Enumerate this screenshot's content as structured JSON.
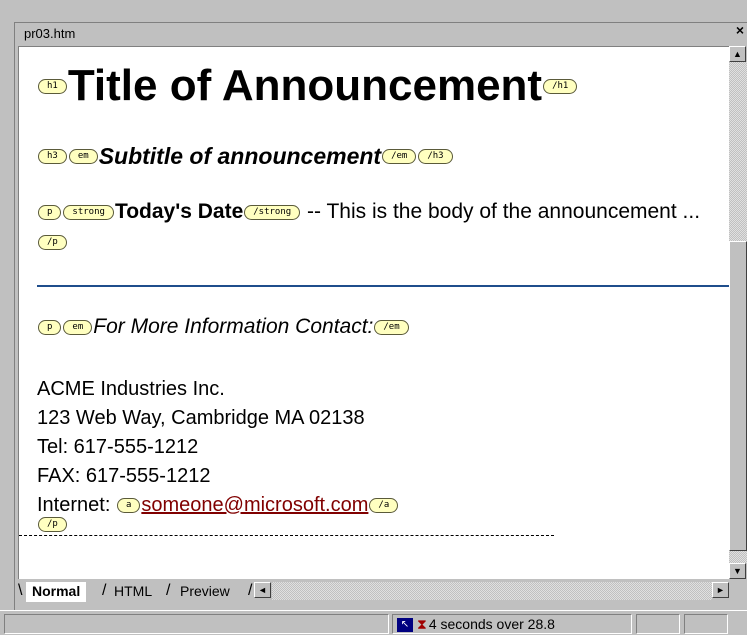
{
  "window": {
    "title": "pr03.htm",
    "close_glyph": "×"
  },
  "document": {
    "h1": {
      "open_tag": "h1",
      "text": "Title of Announcement",
      "close_tag": "/h1"
    },
    "h3": {
      "open_tag": "h3",
      "em_open_tag": "em",
      "text": "Subtitle of announcement",
      "em_close_tag": "/em",
      "close_tag": "/h3"
    },
    "body_paragraph": {
      "p_open_tag": "p",
      "strong_open_tag": "strong",
      "strong_text": "Today's Date",
      "strong_close_tag": "/strong",
      "text_after": " -- This is the body of the announcement ...",
      "p_close_tag": "/p"
    },
    "contact": {
      "p_open_tag": "p",
      "em_open_tag": "em",
      "text": "For More Information Contact:",
      "em_close_tag": "/em",
      "company": "ACME Industries Inc.",
      "street": "123 Web Way, Cambridge MA 02138",
      "tel": "Tel: 617-555-1212",
      "fax": "FAX: 617-555-1212",
      "internet_label": "Internet: ",
      "a_open_tag": "a",
      "email": "someone@microsoft.com",
      "a_close_tag": "/a",
      "p_close_tag": "/p"
    }
  },
  "tabs": [
    {
      "label": "Normal",
      "active": true
    },
    {
      "label": "HTML",
      "active": false
    },
    {
      "label": "Preview",
      "active": false
    }
  ],
  "status": {
    "download_text": "4 seconds over 28.8"
  },
  "colors": {
    "tag_fill": "#ffffc0",
    "link": "#800000",
    "hr": "#1f4e8c"
  },
  "icons": {
    "scroll_up": "up-arrow-icon",
    "scroll_down": "down-arrow-icon",
    "scroll_left": "left-arrow-icon",
    "scroll_right": "right-arrow-icon",
    "status": "cursor-icon",
    "hourglass": "hourglass-icon"
  }
}
